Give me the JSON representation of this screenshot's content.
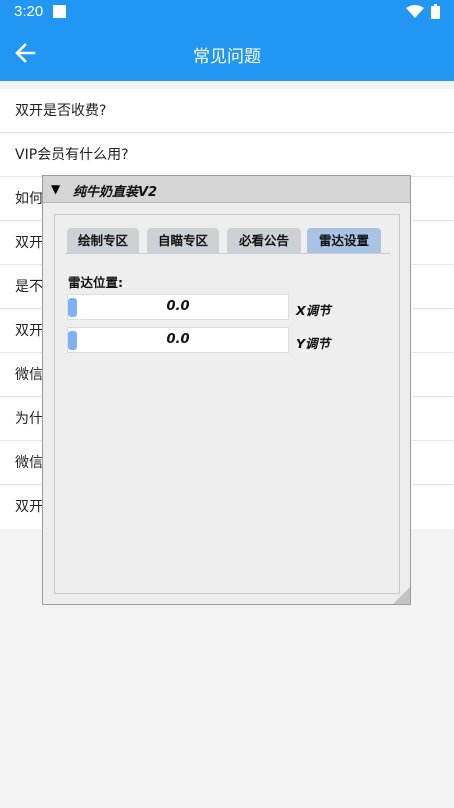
{
  "status_bar": {
    "time": "3:20"
  },
  "app_bar": {
    "title": "常见问题"
  },
  "faq": [
    "双开是否收费?",
    "VIP会员有什么用?",
    "如何",
    "双开",
    "是不",
    "双开",
    "微信",
    "为什",
    "微信",
    "双开"
  ],
  "overlay": {
    "title": "纯牛奶直装V2",
    "tabs": [
      "绘制专区",
      "自瞄专区",
      "必看公告",
      "雷达设置"
    ],
    "active_tab": "雷达设置",
    "section_label": "雷达位置:",
    "sliders": [
      {
        "value": "0.0",
        "label": "X调节"
      },
      {
        "value": "0.0",
        "label": "Y调节"
      }
    ]
  }
}
